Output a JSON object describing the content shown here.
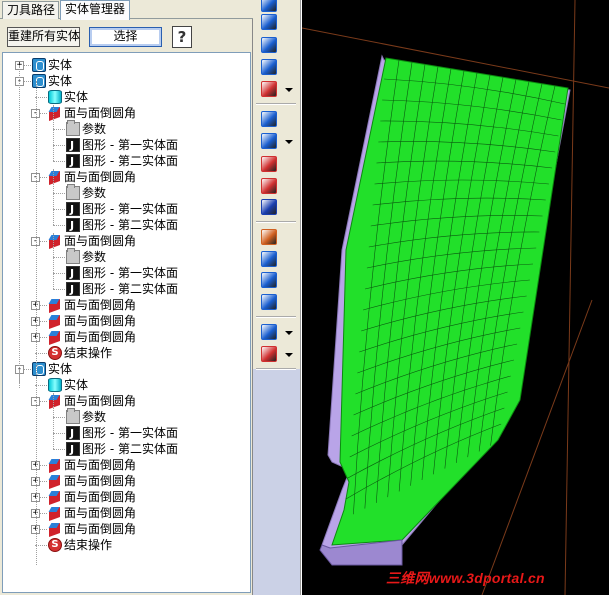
{
  "tabs": [
    "刀具路径",
    "实体管理器"
  ],
  "buttons": {
    "rebuild": "重建所有实体",
    "select": "选择",
    "help": "?"
  },
  "tree": [
    {
      "label": "实体",
      "icon": "solid-icon",
      "expander": "+",
      "level": 0
    },
    {
      "label": "实体",
      "icon": "solid-icon",
      "expander": "-",
      "level": 0
    },
    {
      "label": "实体",
      "icon": "cylinder-icon",
      "level": 1
    },
    {
      "label": "面与面倒圆角",
      "icon": "fillet-icon",
      "expander": "-",
      "level": 1
    },
    {
      "label": "参数",
      "icon": "folder-icon",
      "level": 2
    },
    {
      "label": "图形 - 第一实体面",
      "icon": "shape-icon",
      "level": 2
    },
    {
      "label": "图形 - 第二实体面",
      "icon": "shape-icon",
      "level": 2
    },
    {
      "label": "面与面倒圆角",
      "icon": "fillet-icon",
      "expander": "-",
      "level": 1
    },
    {
      "label": "参数",
      "icon": "folder-icon",
      "level": 2
    },
    {
      "label": "图形 - 第一实体面",
      "icon": "shape-icon",
      "level": 2
    },
    {
      "label": "图形 - 第二实体面",
      "icon": "shape-icon",
      "level": 2
    },
    {
      "label": "面与面倒圆角",
      "icon": "fillet-icon",
      "expander": "-",
      "level": 1
    },
    {
      "label": "参数",
      "icon": "folder-icon",
      "level": 2
    },
    {
      "label": "图形 - 第一实体面",
      "icon": "shape-icon",
      "level": 2
    },
    {
      "label": "图形 - 第二实体面",
      "icon": "shape-icon",
      "level": 2
    },
    {
      "label": "面与面倒圆角",
      "icon": "fillet-icon",
      "expander": "+",
      "level": 1
    },
    {
      "label": "面与面倒圆角",
      "icon": "fillet-icon",
      "expander": "+",
      "level": 1
    },
    {
      "label": "面与面倒圆角",
      "icon": "fillet-icon",
      "expander": "+",
      "level": 1
    },
    {
      "label": "结束操作",
      "icon": "end-operation-icon",
      "level": 1
    },
    {
      "label": "实体",
      "icon": "solid-icon",
      "expander": "-",
      "level": 0
    },
    {
      "label": "实体",
      "icon": "cylinder-icon",
      "level": 1
    },
    {
      "label": "面与面倒圆角",
      "icon": "fillet-icon",
      "expander": "-",
      "level": 1
    },
    {
      "label": "参数",
      "icon": "folder-icon",
      "level": 2
    },
    {
      "label": "图形 - 第一实体面",
      "icon": "shape-icon",
      "level": 2
    },
    {
      "label": "图形 - 第二实体面",
      "icon": "shape-icon",
      "level": 2
    },
    {
      "label": "面与面倒圆角",
      "icon": "fillet-icon",
      "expander": "+",
      "level": 1
    },
    {
      "label": "面与面倒圆角",
      "icon": "fillet-icon",
      "expander": "+",
      "level": 1
    },
    {
      "label": "面与面倒圆角",
      "icon": "fillet-icon",
      "expander": "+",
      "level": 1
    },
    {
      "label": "面与面倒圆角",
      "icon": "fillet-icon",
      "expander": "+",
      "level": 1
    },
    {
      "label": "面与面倒圆角",
      "icon": "fillet-icon",
      "expander": "+",
      "level": 1
    },
    {
      "label": "结束操作",
      "icon": "end-operation-icon",
      "level": 1
    }
  ],
  "toolbar": [
    {
      "icon": "arrow-up-icon",
      "color": "#1a5fd0"
    },
    {
      "icon": "rotate-icon",
      "color": "#1a5fd0"
    },
    {
      "icon": "arc-icon",
      "color": "#1a5fd0"
    },
    {
      "icon": "arrow-down-icon",
      "color": "#1a5fd0"
    },
    {
      "icon": "draft-icon",
      "color": "#d03030",
      "dropdown": true
    },
    {
      "icon": "shell-icon",
      "color": "#1a5fd0"
    },
    {
      "icon": "boolean-icon",
      "color": "#1a5fd0",
      "dropdown": true
    },
    {
      "icon": "trim-icon",
      "color": "#d03030"
    },
    {
      "icon": "thicken-icon",
      "color": "#d03030"
    },
    {
      "icon": "box-icon",
      "color": "#1a3fb0"
    },
    {
      "icon": "extrude-icon",
      "color": "#d06020"
    },
    {
      "icon": "layout-icon",
      "color": "#1a5fd0"
    },
    {
      "icon": "eraser-icon",
      "color": "#1a5fd0"
    },
    {
      "icon": "report-icon",
      "color": "#1a5fd0"
    },
    {
      "icon": "views-icon",
      "color": "#1a5fd0",
      "dropdown": true
    },
    {
      "icon": "solid-red-icon",
      "color": "#d03030",
      "dropdown": true
    }
  ],
  "viewport": {
    "model_color": "#22e02a",
    "edge_color": "#b9a4e8",
    "axis_color": "#7a3a1a",
    "background": "#000000"
  },
  "watermark": "三维网www.3dportal.cn"
}
